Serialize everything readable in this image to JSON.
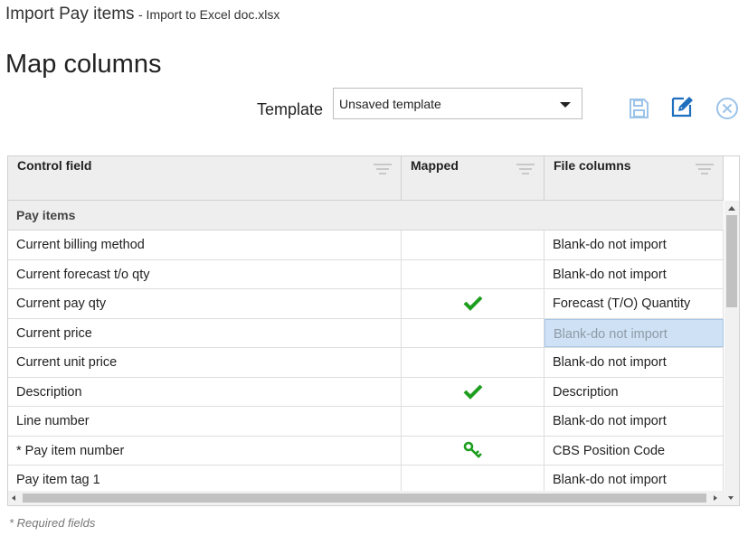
{
  "header": {
    "title": "Import Pay items",
    "subtitle": "- Import to Excel doc.xlsx"
  },
  "page_title": "Map columns",
  "template": {
    "label": "Template",
    "selected": "Unsaved template"
  },
  "toolbar": {
    "save_icon": "save-icon",
    "edit_icon": "edit-icon",
    "close_icon": "close-circle-icon",
    "accent_color": "#4a90d9"
  },
  "grid": {
    "columns": [
      "Control field",
      "Mapped",
      "File columns"
    ],
    "group": "Pay items",
    "rows": [
      {
        "field": "Current billing method",
        "mapped": "",
        "file_column": "Blank-do not import"
      },
      {
        "field": "Current forecast t/o qty",
        "mapped": "",
        "file_column": "Blank-do not import"
      },
      {
        "field": "Current pay qty",
        "mapped": "check",
        "file_column": "Forecast (T/O) Quantity"
      },
      {
        "field": "Current price",
        "mapped": "",
        "file_column": "Blank-do not import",
        "selected": true
      },
      {
        "field": "Current unit price",
        "mapped": "",
        "file_column": "Blank-do not import"
      },
      {
        "field": "Description",
        "mapped": "check",
        "file_column": "Description"
      },
      {
        "field": "Line number",
        "mapped": "",
        "file_column": "Blank-do not import"
      },
      {
        "field": "* Pay item number",
        "mapped": "key",
        "file_column": "CBS Position Code"
      },
      {
        "field": "Pay item tag 1",
        "mapped": "",
        "file_column": "Blank-do not import"
      }
    ],
    "mapped_color": "#1e9e1e"
  },
  "footnote": "* Required fields"
}
